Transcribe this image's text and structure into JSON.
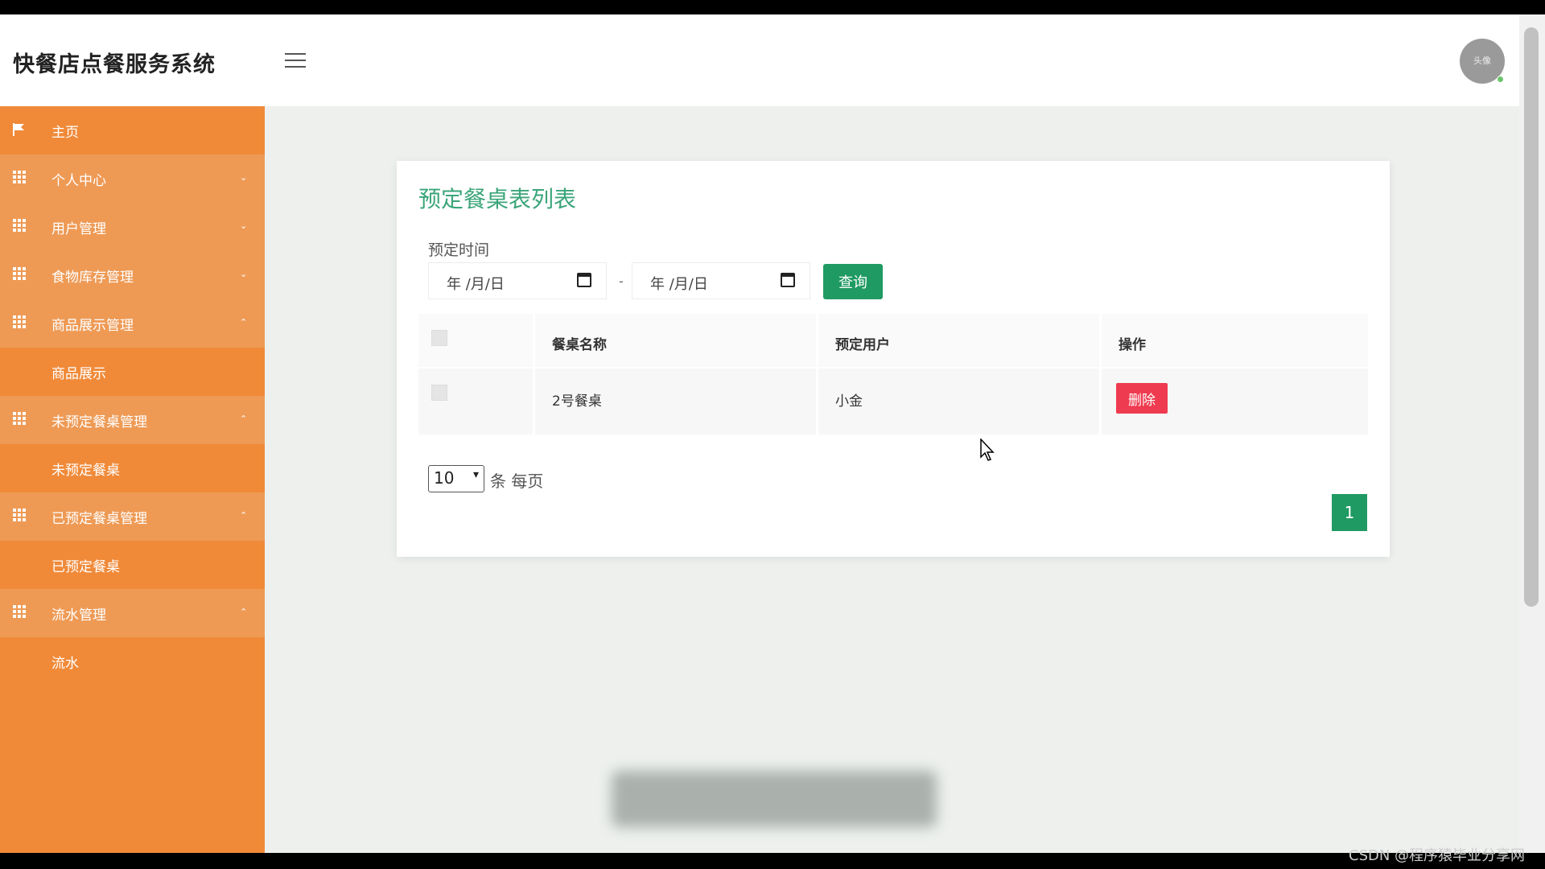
{
  "app": {
    "title": "快餐店点餐服务系统",
    "avatar_text": "头像"
  },
  "sidebar": {
    "items": [
      {
        "label": "主页",
        "icon": "flag-icon",
        "type": "item"
      },
      {
        "label": "个人中心",
        "icon": "grid-icon",
        "type": "section",
        "caret": "⌄"
      },
      {
        "label": "用户管理",
        "icon": "grid-icon",
        "type": "section",
        "caret": "⌄"
      },
      {
        "label": "食物库存管理",
        "icon": "grid-icon",
        "type": "section",
        "caret": "⌄"
      },
      {
        "label": "商品展示管理",
        "icon": "grid-icon",
        "type": "section",
        "caret": "⌃"
      },
      {
        "label": "商品展示",
        "type": "sub"
      },
      {
        "label": "未预定餐桌管理",
        "icon": "grid-icon",
        "type": "section",
        "caret": "⌃"
      },
      {
        "label": "未预定餐桌",
        "type": "sub"
      },
      {
        "label": "已预定餐桌管理",
        "icon": "grid-icon",
        "type": "section",
        "caret": "⌃"
      },
      {
        "label": "已预定餐桌",
        "type": "sub"
      },
      {
        "label": "流水管理",
        "icon": "grid-icon",
        "type": "section",
        "caret": "⌃"
      },
      {
        "label": "流水",
        "type": "sub"
      }
    ]
  },
  "main": {
    "title": "预定餐桌表列表",
    "filter": {
      "label": "预定时间",
      "date_placeholder": "年 /月/日",
      "separator": "-",
      "query_label": "查询"
    },
    "table": {
      "columns": [
        "餐桌名称",
        "预定用户",
        "操作"
      ],
      "rows": [
        {
          "table_name": "2号餐桌",
          "user": "小金",
          "action": "删除"
        }
      ]
    },
    "pagination": {
      "page_size": "10",
      "page_size_label": "条 每页",
      "current_page": "1"
    }
  },
  "watermark": "CSDN @程序猿毕业分享网",
  "colors": {
    "sidebar": "#f08a39",
    "accent": "#1f9a62",
    "title": "#3ba57a",
    "danger": "#ef3b4f"
  }
}
